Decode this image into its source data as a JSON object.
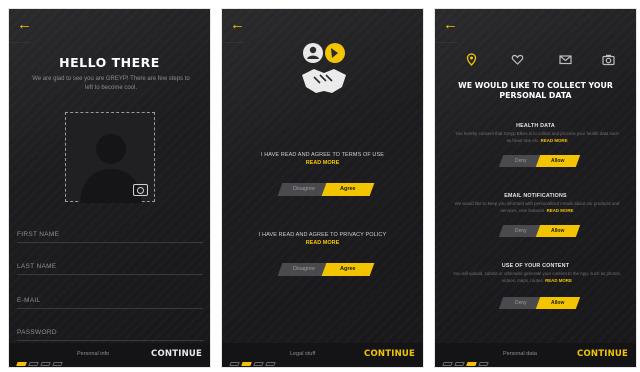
{
  "screen1": {
    "title": "HELLO THERE",
    "subtitle": "We are glad to see you are GREYP! There are few steps to left to become cool.",
    "fields": [
      {
        "placeholder": "FIRST NAME"
      },
      {
        "placeholder": "LAST NAME"
      },
      {
        "placeholder": "E-MAIL"
      },
      {
        "placeholder": "PASSWORD"
      }
    ],
    "step_label": "Personal info",
    "continue": "CONTINUE",
    "active_step": 1
  },
  "screen2": {
    "terms_text": "I HAVE READ AND AGREE TO TERMS OF USE",
    "terms_read_more": "READ MORE",
    "terms_toggle": {
      "off": "Disagree",
      "on": "Agree"
    },
    "privacy_text": "I HAVE READ AND AGREE TO PRIVACY POLICY",
    "privacy_read_more": "READ MORE",
    "privacy_toggle": {
      "off": "Disagree",
      "on": "Agree"
    },
    "step_label": "Legal stuff",
    "continue": "CONTINUE",
    "active_step": 2
  },
  "screen3": {
    "title_line1": "WE WOULD LIKE TO COLLECT YOUR",
    "title_line2": "PERSONAL DATA",
    "sections": [
      {
        "title": "HEALTH DATA",
        "body": "You hereby consent that Greyp Bikes is to collect and process your health data such as heart rate etc.",
        "read_more": "READ MORE",
        "toggle": {
          "off": "Deny",
          "on": "Allow"
        }
      },
      {
        "title": "EMAIL NOTIFICATIONS",
        "body": "We would like to keep you informed with personalized emails about our products and services, new features.",
        "read_more": "READ MORE",
        "toggle": {
          "off": "Deny",
          "on": "Allow"
        }
      },
      {
        "title": "USE OF YOUR CONTENT",
        "body": "You will upload, submit or otherwise generate your content to the App, such as photos, videos, maps, routes.",
        "read_more": "READ MORE",
        "toggle": {
          "off": "Deny",
          "on": "Allow"
        }
      }
    ],
    "step_label": "Personal data",
    "continue": "CONTINUE",
    "active_step": 3
  },
  "colors": {
    "accent": "#f2c500",
    "background": "#1d1d20"
  },
  "icons": [
    "back-arrow-icon",
    "camera-icon",
    "location-pin-icon",
    "heart-icon",
    "mail-icon",
    "camera-icon"
  ]
}
